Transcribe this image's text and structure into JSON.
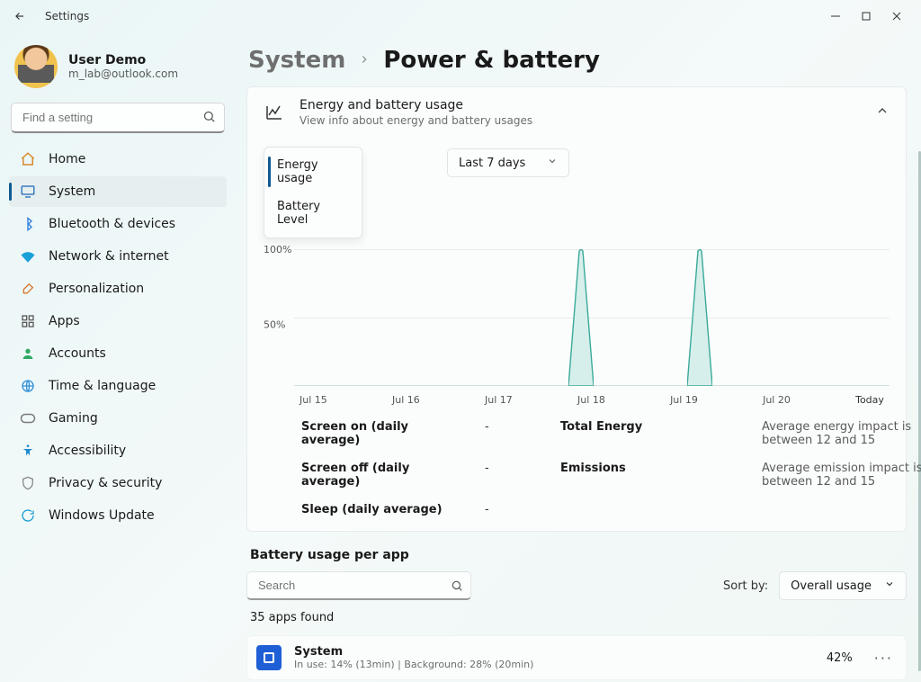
{
  "window": {
    "title": "Settings"
  },
  "user": {
    "name": "User Demo",
    "email": "m_lab@outlook.com"
  },
  "search": {
    "placeholder": "Find a setting"
  },
  "nav": {
    "items": [
      {
        "label": "Home"
      },
      {
        "label": "System"
      },
      {
        "label": "Bluetooth & devices"
      },
      {
        "label": "Network & internet"
      },
      {
        "label": "Personalization"
      },
      {
        "label": "Apps"
      },
      {
        "label": "Accounts"
      },
      {
        "label": "Time & language"
      },
      {
        "label": "Gaming"
      },
      {
        "label": "Accessibility"
      },
      {
        "label": "Privacy & security"
      },
      {
        "label": "Windows Update"
      }
    ],
    "active_index": 1
  },
  "breadcrumb": {
    "root": "System",
    "page": "Power & battery"
  },
  "energy_panel": {
    "title": "Energy and battery usage",
    "subtitle": "View info about energy and battery usages",
    "tabs": {
      "energy": "Energy usage",
      "battery": "Battery Level"
    },
    "range": "Last 7 days"
  },
  "chart_data": {
    "type": "area",
    "ylabel": "",
    "ylim": [
      0,
      100
    ],
    "yticks": [
      "100%",
      "50%"
    ],
    "categories": [
      "Jul 15",
      "Jul 16",
      "Jul 17",
      "Jul 18",
      "Jul 19",
      "Jul 20",
      "Today"
    ],
    "series": [
      {
        "name": "Energy usage",
        "values": [
          0,
          0,
          0,
          100,
          100,
          0,
          0
        ],
        "note": "Two narrow spikes to ~100% near Jul 18 and Jul 19; otherwise ~0"
      }
    ]
  },
  "stats": {
    "screen_on_label": "Screen on (daily average)",
    "screen_on_value": "-",
    "screen_off_label": "Screen off (daily average)",
    "screen_off_value": "-",
    "sleep_label": "Sleep (daily average)",
    "sleep_value": "-",
    "total_energy_label": "Total Energy",
    "total_energy_desc": "Average energy impact is between 12 and 15",
    "emissions_label": "Emissions",
    "emissions_desc": "Average emission impact is between 12 and 15"
  },
  "per_app": {
    "title": "Battery usage per app",
    "search_placeholder": "Search",
    "sort_by_label": "Sort by:",
    "sort_value": "Overall usage",
    "count_text": "35 apps found",
    "rows": [
      {
        "name": "System",
        "detail": "In use: 14% (13min) | Background: 28% (20min)",
        "pct": "42%"
      }
    ]
  }
}
